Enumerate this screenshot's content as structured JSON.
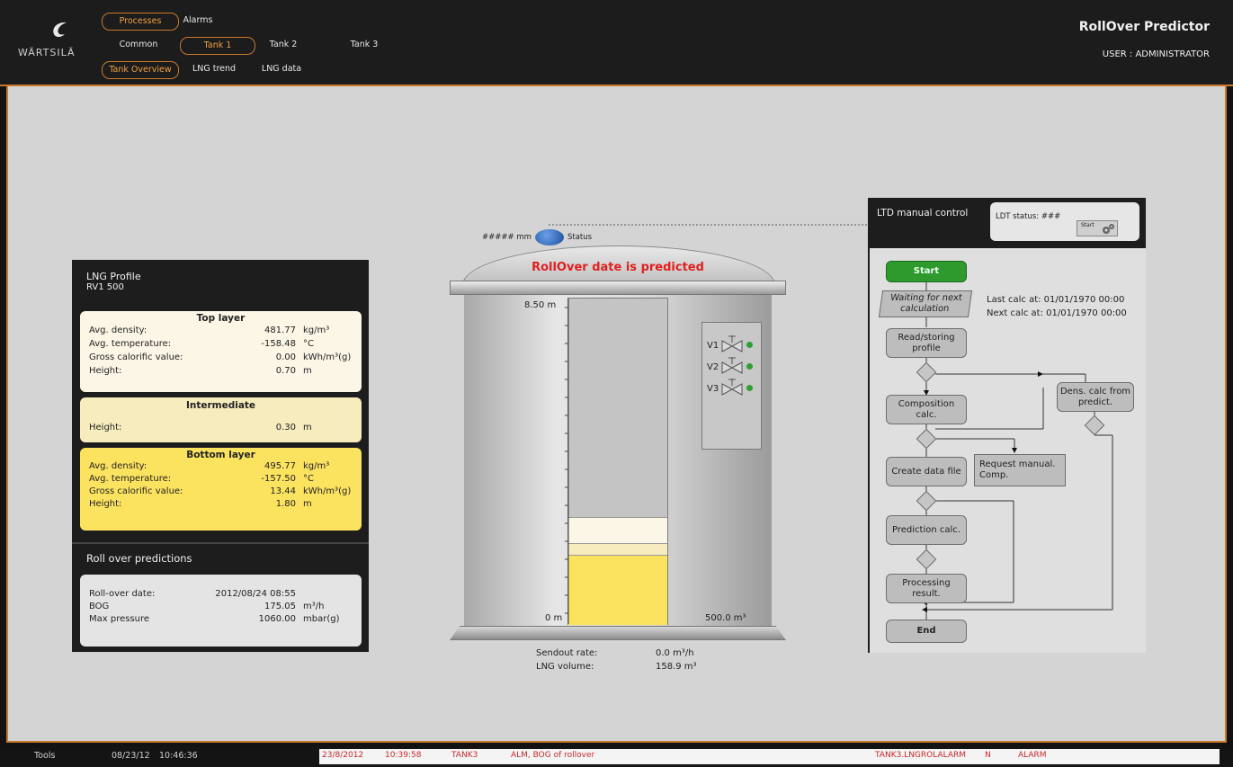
{
  "header": {
    "logo_text": "WÄRTSILÄ",
    "nav_row1": [
      "Processes",
      "Alarms"
    ],
    "nav_row2": [
      "Common",
      "Tank 1",
      "Tank 2",
      "Tank 3"
    ],
    "nav_row3": [
      "Tank Overview",
      "LNG trend",
      "LNG data"
    ],
    "app_title": "RollOver Predictor",
    "user": "USER : ADMINISTRATOR"
  },
  "lng_profile": {
    "title": "LNG Profile",
    "subtitle": "RV1 500",
    "top_layer": {
      "title": "Top layer",
      "rows": [
        {
          "label": "Avg. density:",
          "value": "481.77",
          "unit": "kg/m³"
        },
        {
          "label": "Avg. temperature:",
          "value": "-158.48",
          "unit": "°C"
        },
        {
          "label": "Gross calorific value:",
          "value": "0.00",
          "unit": "kWh/m³(g)"
        },
        {
          "label": "Height:",
          "value": "0.70",
          "unit": "m"
        }
      ]
    },
    "intermediate": {
      "title": "Intermediate",
      "rows": [
        {
          "label": "Height:",
          "value": "0.30",
          "unit": "m"
        }
      ]
    },
    "bottom_layer": {
      "title": "Bottom layer",
      "rows": [
        {
          "label": "Avg. density:",
          "value": "495.77",
          "unit": "kg/m³"
        },
        {
          "label": "Avg. temperature:",
          "value": "-157.50",
          "unit": "°C"
        },
        {
          "label": "Gross calorific value:",
          "value": "13.44",
          "unit": "kWh/m³(g)"
        },
        {
          "label": "Height:",
          "value": "1.80",
          "unit": "m"
        }
      ]
    }
  },
  "predictions": {
    "title": "Roll over predictions",
    "rows": [
      {
        "label": "Roll-over date:",
        "value": "2012/08/24  08:55",
        "unit": ""
      },
      {
        "label": "BOG",
        "value": "175.05",
        "unit": "m³/h"
      },
      {
        "label": "Max pressure",
        "value": "1060.00",
        "unit": "mbar(g)"
      }
    ]
  },
  "tank": {
    "sensor_value": "##### mm",
    "status_label": "Status",
    "banner": "RollOver date is predicted",
    "gauge_top": "8.50  m",
    "gauge_bottom": "0 m",
    "capacity": "500.0  m³",
    "valves": [
      "V1",
      "V2",
      "V3"
    ],
    "sendout_label": "Sendout rate:",
    "sendout_value": "0.0 m³/h",
    "volume_label": "LNG volume:",
    "volume_value": "158.9 m³"
  },
  "ltd": {
    "title": "LTD manual control",
    "status": "LDT status: ###",
    "start_btn": "Start",
    "flow": {
      "start": "Start",
      "waiting": "Waiting for next calculation",
      "last_calc": "Last calc at:  01/01/1970 00:00",
      "next_calc": "Next calc at:  01/01/1970 00:00",
      "read": "Read/storing profile",
      "composition": "Composition calc.",
      "dens": "Dens. calc from predict.",
      "create": "Create data file",
      "request": "Request manual. Comp.",
      "prediction": "Prediction calc.",
      "processing": "Processing result.",
      "end": "End"
    }
  },
  "statusbar": {
    "tools": "Tools",
    "date": "08/23/12",
    "time": "10:46:36",
    "alarm_date": "23/8/2012",
    "alarm_time": "10:39:58",
    "alarm_tank": "TANK3",
    "alarm_text": "ALM, BOG of rollover",
    "alarm_tag": "TANK3.LNGROLALARM",
    "alarm_flag": "N",
    "alarm_type": "ALARM"
  },
  "colors": {
    "accent": "#c8782a",
    "top_layer": "#fbf6e6",
    "intermediate": "#f7ecbd",
    "bottom_layer": "#fce35f",
    "start_green": "#2e9a2e",
    "alarm_red": "#e02020"
  }
}
